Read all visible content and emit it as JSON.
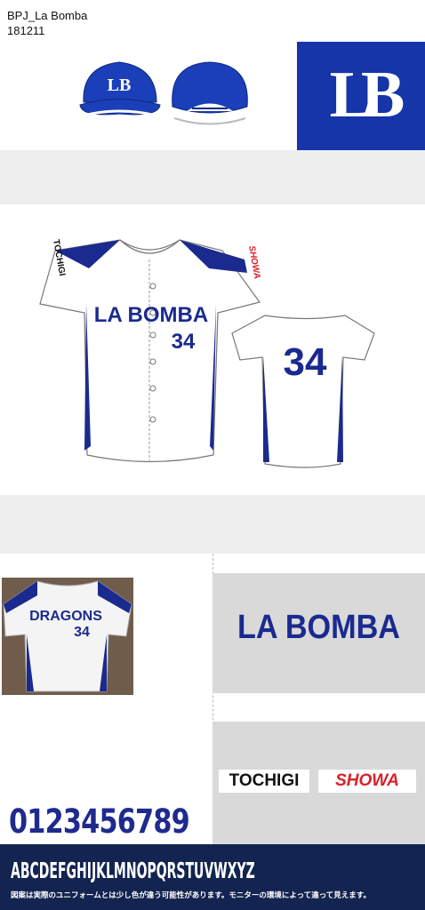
{
  "header": {
    "title": "BPJ_La Bomba",
    "date": "181211"
  },
  "colors": {
    "navy": "#1f2a8f",
    "royal_blue": "#1535a8",
    "red": "#d9202a",
    "panel_grey": "#d9d9d9",
    "footer_navy": "#12244f"
  },
  "logo": {
    "text": "LB"
  },
  "jersey": {
    "chest_text": "LA BOMBA",
    "number": "34",
    "sleeve_left": "TOCHIGI",
    "sleeve_right": "SHOWA"
  },
  "photo": {
    "chest_text": "DRAGONS",
    "number": "34"
  },
  "wordmark": "LA BOMBA",
  "tags": {
    "tochigi": "TOCHIGI",
    "showa": "SHOWA"
  },
  "font_samples": {
    "numbers": "0123456789",
    "alphabet": "ABCDEFGHIJKLMNOPQRSTUVWXYZ"
  },
  "notice": "図案は実際のユニフォームとは少し色が違う可能性があります。モニターの環境によって違って見えます。"
}
